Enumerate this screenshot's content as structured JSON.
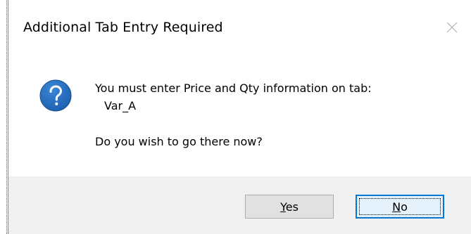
{
  "dialog": {
    "title": "Additional Tab Entry Required",
    "icon": "question-icon",
    "icon_color": "#1c5fae",
    "message": {
      "line1": "You must enter Price and Qty information on tab:",
      "tab_name": "Var_A",
      "question": "Do you wish to go there now?"
    },
    "buttons": {
      "yes": {
        "mnemonic": "Y",
        "rest": "es"
      },
      "no": {
        "mnemonic": "N",
        "rest": "o",
        "focused": true
      }
    }
  },
  "colors": {
    "footer_background": "#f0f0f0",
    "focus_border": "#0078d7",
    "button_face": "#e1e1e1"
  }
}
